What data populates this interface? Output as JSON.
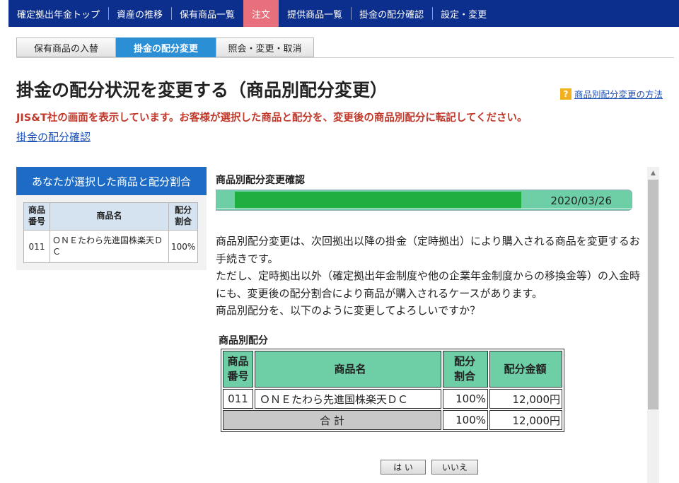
{
  "nav": {
    "items": [
      {
        "label": "確定拠出年金トップ"
      },
      {
        "label": "資産の推移"
      },
      {
        "label": "保有商品一覧"
      },
      {
        "label": "注文"
      },
      {
        "label": "提供商品一覧"
      },
      {
        "label": "掛金の配分確認"
      },
      {
        "label": "設定・変更"
      }
    ],
    "active_index": 3,
    "bg_color": "#0c2e8c",
    "active_color": "#e8707c"
  },
  "subtabs": {
    "items": [
      {
        "label": "保有商品の入替"
      },
      {
        "label": "掛金の配分変更"
      },
      {
        "label": "照会・変更・取消"
      }
    ],
    "active_index": 1
  },
  "page": {
    "title": "掛金の配分状況を変更する（商品別配分変更）",
    "help_icon": "?",
    "help_link": "商品別配分変更の方法",
    "notice": "JIS&T社の画面を表示しています。お客様が選択した商品と配分を、変更後の商品別配分に転記してください。",
    "confirm_link": "掛金の配分確認"
  },
  "left_panel": {
    "header": "あなたが選択した商品と配分割合",
    "columns": [
      "商品番号",
      "商品名",
      "配分割合"
    ],
    "column_lines": [
      [
        "商品",
        "番号"
      ],
      [
        "商品名"
      ],
      [
        "配分",
        "割合"
      ]
    ],
    "rows": [
      {
        "code": "011",
        "name": "ＯＮＥたわら先進国株楽天ＤＣ",
        "ratio": "100%"
      }
    ]
  },
  "confirm": {
    "section_title": "商品別配分変更確認",
    "progress_date": "2020/03/26",
    "progress_color": "#1fae3f",
    "description": [
      "商品別配分変更は、次回拠出以降の掛金（定時拠出）により購入される商品を変更するお手続きです。",
      "ただし、定時拠出以外（確定拠出年金制度や他の企業年金制度からの移換金等）の入金時にも、変更後の配分割合により商品が購入されるケースがあります。",
      "商品別配分を、以下のように変更してよろしいですか？"
    ],
    "table_title": "商品別配分",
    "columns": [
      {
        "lines": [
          "商品",
          "番号"
        ]
      },
      {
        "lines": [
          "商品名"
        ]
      },
      {
        "lines": [
          "配分",
          "割合"
        ]
      },
      {
        "lines": [
          "配分金額"
        ]
      }
    ],
    "rows": [
      {
        "code": "011",
        "name": "ＯＮＥたわら先進国株楽天ＤＣ",
        "ratio": "100%",
        "amount": "12,000円"
      }
    ],
    "total": {
      "label": "合 計",
      "ratio": "100%",
      "amount": "12,000円"
    },
    "header_color": "#6ecea6",
    "buttons": {
      "yes": "は い",
      "no": "いいえ"
    }
  }
}
